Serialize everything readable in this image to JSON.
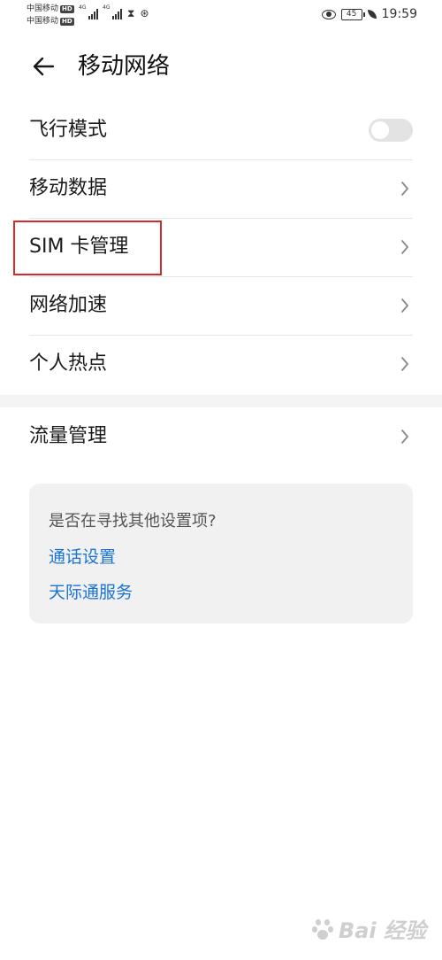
{
  "status_bar": {
    "carrier1": "中国移动",
    "carrier2": "中国移动",
    "hd": "HD",
    "net1": "4G",
    "net2": "4G",
    "battery": "45",
    "time": "19:59"
  },
  "header": {
    "title": "移动网络"
  },
  "settings": {
    "airplane": {
      "label": "飞行模式",
      "enabled": false
    },
    "mobile_data": {
      "label": "移动数据"
    },
    "sim": {
      "label": "SIM 卡管理"
    },
    "accel": {
      "label": "网络加速"
    },
    "hotspot": {
      "label": "个人热点"
    },
    "traffic": {
      "label": "流量管理"
    }
  },
  "suggestions": {
    "question": "是否在寻找其他设置项?",
    "links": [
      "通话设置",
      "天际通服务"
    ]
  },
  "watermark": {
    "text": "Bai 经验"
  },
  "colors": {
    "link": "#1a73d8",
    "highlight": "#d42a2a",
    "card_bg": "#f1f1f1"
  }
}
